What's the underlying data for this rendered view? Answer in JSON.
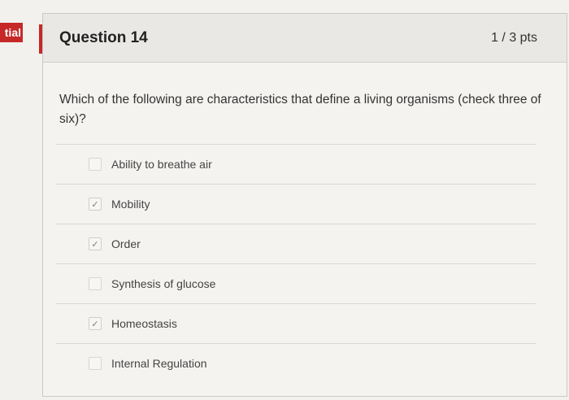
{
  "side_tab": {
    "label": "tial"
  },
  "question": {
    "title": "Question 14",
    "points": "1 / 3 pts",
    "text": "Which of the following are characteristics that define a living organisms (check three of six)?"
  },
  "answers": [
    {
      "label": "Ability to breathe air",
      "checked": false
    },
    {
      "label": "Mobility",
      "checked": true
    },
    {
      "label": "Order",
      "checked": true
    },
    {
      "label": "Synthesis of glucose",
      "checked": false
    },
    {
      "label": "Homeostasis",
      "checked": true
    },
    {
      "label": "Internal Regulation",
      "checked": false
    }
  ],
  "colors": {
    "accent": "#c62828"
  }
}
